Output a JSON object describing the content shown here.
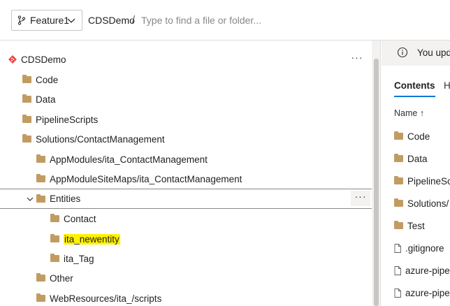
{
  "header": {
    "branch": "Feature1",
    "repo": "CDSDemo",
    "separator": "/",
    "search_placeholder": "Type to find a file or folder..."
  },
  "tree": {
    "root": "CDSDemo",
    "more": "···",
    "items": [
      {
        "label": "Code"
      },
      {
        "label": "Data"
      },
      {
        "label": "PipelineScripts"
      },
      {
        "label": "Solutions/ContactManagement"
      },
      {
        "label": "AppModules/ita_ContactManagement"
      },
      {
        "label": "AppModuleSiteMaps/ita_ContactManagement"
      },
      {
        "label": "Entities"
      },
      {
        "label": "Contact"
      },
      {
        "label": "ita_newentity"
      },
      {
        "label": "ita_Tag"
      },
      {
        "label": "Other"
      },
      {
        "label": "WebResources/ita_/scripts"
      }
    ]
  },
  "right": {
    "banner_text": "You upd",
    "tabs": [
      "Contents",
      "H"
    ],
    "column_header": "Name ↑",
    "rows": [
      {
        "label": "Code",
        "icon": "folder-icon"
      },
      {
        "label": "Data",
        "icon": "folder-icon"
      },
      {
        "label": "PipelineSc",
        "icon": "folder-icon"
      },
      {
        "label": "Solutions/",
        "icon": "folder-icon"
      },
      {
        "label": "Test",
        "icon": "folder-icon"
      },
      {
        "label": ".gitignore",
        "icon": "file-icon"
      },
      {
        "label": "azure-pipe",
        "icon": "file-icon"
      },
      {
        "label": "azure-pipe",
        "icon": "file-icon"
      }
    ]
  },
  "colors": {
    "folder": "#c19c62",
    "git": "#e8473e",
    "highlight": "#fff200",
    "accent": "#0078d4"
  }
}
